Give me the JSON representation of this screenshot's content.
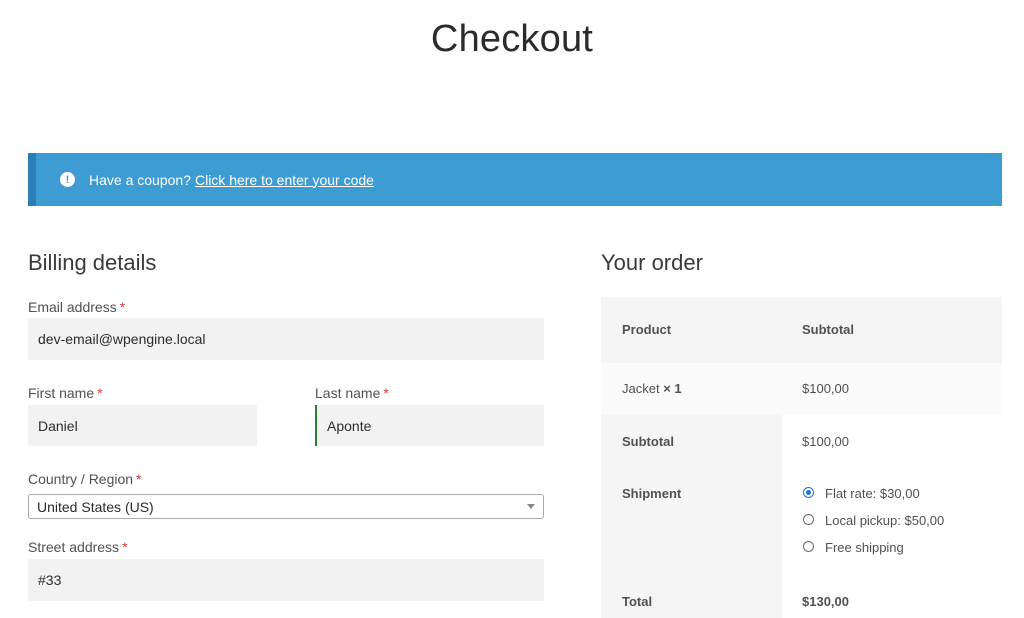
{
  "page": {
    "title": "Checkout"
  },
  "coupon": {
    "icon": "info-icon",
    "icon_glyph": "!",
    "text": "Have a coupon?",
    "link": "Click here to enter your code"
  },
  "billing": {
    "heading": "Billing details",
    "email": {
      "label": "Email address",
      "value": "dev-email@wpengine.local"
    },
    "first_name": {
      "label": "First name",
      "value": "Daniel"
    },
    "last_name": {
      "label": "Last name",
      "value": "Aponte"
    },
    "country": {
      "label": "Country / Region",
      "value": "United States (US)"
    },
    "street": {
      "label": "Street address",
      "value": "#33"
    },
    "required_mark": "*"
  },
  "order": {
    "heading": "Your order",
    "col_product": "Product",
    "col_subtotal": "Subtotal",
    "item_name": "Jacket",
    "item_qty": "× 1",
    "item_price": "$100,00",
    "subtotal_label": "Subtotal",
    "subtotal_value": "$100,00",
    "shipment_label": "Shipment",
    "shipping_options": [
      {
        "label": "Flat rate: $30,00",
        "selected": true
      },
      {
        "label": "Local pickup: $50,00",
        "selected": false
      },
      {
        "label": "Free shipping",
        "selected": false
      }
    ],
    "total_label": "Total",
    "total_value": "$130,00"
  },
  "colors": {
    "accent": "#3d9cd2",
    "required": "#d63638",
    "table_bg": "#f7f7f7"
  }
}
